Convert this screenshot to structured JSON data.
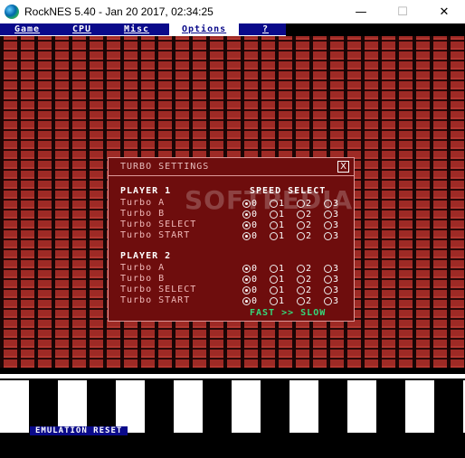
{
  "window": {
    "title": "RockNES 5.40 - Jan 20 2017, 02:34:25",
    "controls": {
      "minimize": "—",
      "maximize": "☐",
      "close": "✕"
    }
  },
  "menu": {
    "items": [
      "Game",
      "CPU",
      "Misc",
      "Options",
      "?"
    ],
    "active_index": 3
  },
  "dialog": {
    "title": "TURBO SETTINGS",
    "close_label": "X",
    "speed_header": "SPEED SELECT",
    "player1": {
      "label": "PLAYER 1",
      "rows": [
        {
          "label": "Turbo A",
          "selected": 0
        },
        {
          "label": "Turbo B",
          "selected": 0
        },
        {
          "label": "Turbo SELECT",
          "selected": 0
        },
        {
          "label": "Turbo START",
          "selected": 0
        }
      ]
    },
    "player2": {
      "label": "PLAYER 2",
      "rows": [
        {
          "label": "Turbo A",
          "selected": 0
        },
        {
          "label": "Turbo B",
          "selected": 0
        },
        {
          "label": "Turbo SELECT",
          "selected": 0
        },
        {
          "label": "Turbo START",
          "selected": 0
        }
      ]
    },
    "options": [
      "0",
      "1",
      "2",
      "3"
    ],
    "speed_legend": "FAST >> SLOW"
  },
  "status": {
    "text": "EMULATION RESET"
  },
  "watermark": "SOFTPEDIA",
  "colors": {
    "menu_bg": "#0a0a8a",
    "dialog_bg": "#6e0d0d",
    "brick": "#9e2a25",
    "legend_green": "#35d87a"
  }
}
